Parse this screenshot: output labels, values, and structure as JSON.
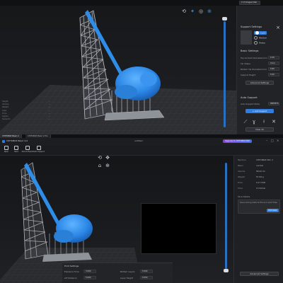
{
  "top": {
    "topbar": {
      "dropdown_value": "2 of images total"
    },
    "stats": [
      {
        "label": "Height",
        "value": "—"
      },
      {
        "label": "Volume",
        "value": "—"
      },
      {
        "label": "Weight",
        "value": "—"
      },
      {
        "label": "Area",
        "value": "—"
      },
      {
        "label": "Time",
        "value": "—"
      },
      {
        "label": "Layers",
        "value": "—"
      },
      {
        "label": "Supports",
        "value": "—"
      }
    ],
    "bottom_tabs": [
      "CHITUBOX Basic 2",
      "CHITUBOX Basic 2 Pro"
    ],
    "panel": {
      "header": "Support Settings",
      "density_options": [
        "Light",
        "Medium",
        "Heavy"
      ],
      "density_selected": "Light",
      "basic_header": "Basic Settings",
      "fields": [
        {
          "label": "Top Contact Diameter(mm)",
          "value": "0.30"
        },
        {
          "label": "Tip Shape",
          "value": "Cone"
        },
        {
          "label": "Bottom Tip Diameter(mm)",
          "value": "0.80"
        },
        {
          "label": "Support Height",
          "value": "5.00"
        }
      ],
      "advanced_button": "Advanced Settings",
      "auto_header": "Auto Support",
      "auto_mode_label": "Auto Support Mode",
      "auto_mode_value": "PRESETS",
      "add_button": "+ Add Support",
      "clear_button": "Clear All"
    }
  },
  "bottom": {
    "app_title": "CHITUBOX Basic 2.0",
    "window_title": "untitled",
    "badge": "Upgrade to CHITUBOX PRO",
    "toolbar": [
      "Open",
      "Save",
      "Slice & Export",
      "Auto Support",
      "Settings"
    ],
    "panel": {
      "kv": [
        {
          "k": "Machine",
          "v": "CHITUBOX Mini 3"
        },
        {
          "k": "Resin",
          "v": "normal"
        },
        {
          "k": "Volume",
          "v": "58.22 ml"
        },
        {
          "k": "Weight",
          "v": "57.09 g"
        },
        {
          "k": "Price",
          "v": "0.17 USD"
        },
        {
          "k": "Time",
          "v": "1h 52min"
        }
      ],
      "notes_label": "Slice Details",
      "notes_text": "Save slicing data to file and print files",
      "notes_button": "Edit Detail",
      "slice_button": "Advanced Settings"
    },
    "print_settings": {
      "title": "Print Settings",
      "rows": [
        {
          "label": "Exposure Time",
          "value": "3.000",
          "label2": "Bottom Layers",
          "value2": "5.000"
        },
        {
          "label": "Lift Distance",
          "value": "5.000",
          "label2": "Layer Height",
          "value2": "0.050"
        }
      ]
    }
  },
  "colors": {
    "accent": "#2f7de0",
    "model": "#2e8de8",
    "support": "#9a9fa6",
    "bed": "#3a3b3f"
  }
}
